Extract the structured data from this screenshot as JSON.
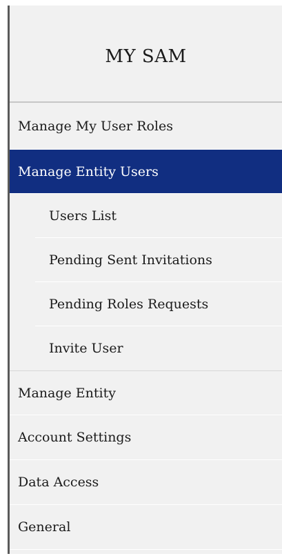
{
  "sidebar": {
    "title": "MY SAM",
    "items": [
      {
        "label": "Manage My User Roles"
      },
      {
        "label": "Manage Entity Users"
      },
      {
        "label": "Manage Entity"
      },
      {
        "label": "Account Settings"
      },
      {
        "label": "Data Access"
      },
      {
        "label": "General"
      }
    ],
    "active_index": 1,
    "subitems": [
      {
        "label": "Users List"
      },
      {
        "label": "Pending Sent Invitations"
      },
      {
        "label": "Pending Roles Requests"
      },
      {
        "label": "Invite User"
      }
    ]
  },
  "colors": {
    "active_background": "#112e81",
    "sidebar_background": "#f1f1f1"
  }
}
